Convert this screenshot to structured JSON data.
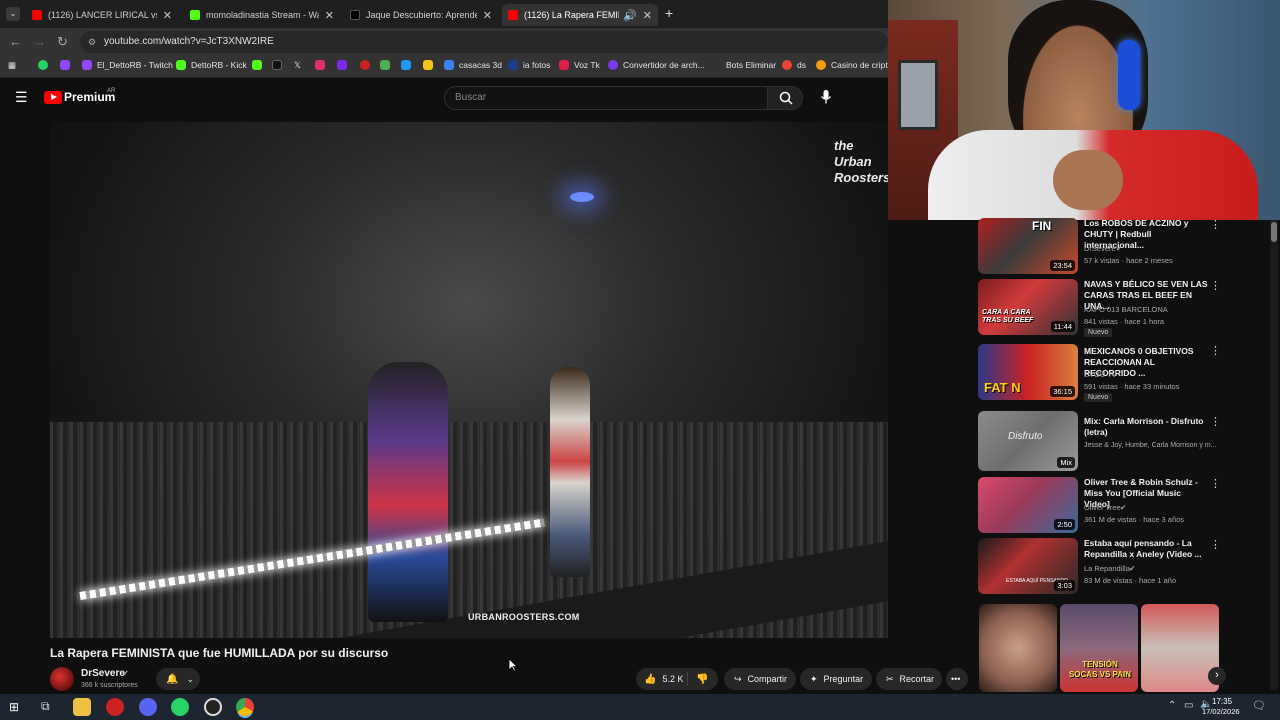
{
  "tabs": [
    {
      "title": "(1126) LANCER LIRICAL vs CHA",
      "active": false
    },
    {
      "title": "momoladinastia Stream - Watc",
      "active": false
    },
    {
      "title": "Jaque Descubierto: Aprender d",
      "active": false
    },
    {
      "title": "(1126) La Rapera FEMINIST",
      "active": true
    }
  ],
  "address": {
    "url": "youtube.com/watch?v=JcT3XNW2IRE"
  },
  "bookmarks": [
    "El_DettoRB - Twitch",
    "DettoRB - Kick",
    "casacas 3d",
    "ia fotos",
    "Voz Tk",
    "Convertidor de arch...",
    "Bots Eliminar",
    "ds",
    "Casino de cripto"
  ],
  "youtube": {
    "logo_text": "Premium",
    "logo_region": "AR",
    "search_placeholder": "Buscar"
  },
  "video": {
    "watermark": "URBANROOSTERS.COM",
    "corner_logo": "the Urban Roosters",
    "title": "La Rapera FEMINISTA que fue HUMILLADA por su discurso",
    "channel": "DrSevere",
    "subscribers": "366 k suscriptores",
    "likes": "5.2 K",
    "share_label": "Compartir",
    "ask_label": "Preguntar",
    "clip_label": "Recortar"
  },
  "recommendations": [
    {
      "title": "Los ROBOS DE ACZINO y CHUTY | Redbull internacional...",
      "channel": "DrSevere",
      "verified": true,
      "meta": "57 k vistas · hace 2 meses",
      "duration": "23:54",
      "nuevo": false,
      "thumb_text": "FIN"
    },
    {
      "title": "NAVAS Y BÉLICO SE VEN LAS CARAS TRAS EL BEEF EN UNA...",
      "channel": "KAPO 013 BARCELONA",
      "verified": false,
      "meta": "841 vistas · hace 1 hora",
      "duration": "11:44",
      "nuevo": true,
      "thumb_text": "CARA A CARA TRAS SU BEEF"
    },
    {
      "title": "MEXICANOS 0 OBJETIVOS REACCIONAN AL RECORRIDO ...",
      "channel": "EYOU TV",
      "verified": false,
      "meta": "591 vistas · hace 33 minutos",
      "duration": "36:15",
      "nuevo": true,
      "thumb_text": "FAT N"
    },
    {
      "title": "Mix: Carla Morrison - Disfruto (letra)",
      "channel": "Jesse & Joy, Humbe, Carla Morrison y m...",
      "verified": false,
      "meta": "",
      "duration": "Mix",
      "nuevo": false,
      "thumb_text": "Disfruto"
    },
    {
      "title": "Oliver Tree & Robin Schulz - Miss You [Official Music Video]",
      "channel": "Oliver Tree",
      "verified": true,
      "meta": "361 M de vistas · hace 3 años",
      "duration": "2:50",
      "nuevo": false,
      "thumb_text": ""
    },
    {
      "title": "Estaba aquí pensando - La Repandilla x Aneley (Video ...",
      "channel": "La Repandilla",
      "verified": true,
      "meta": "83 M de vistas · hace 1 año",
      "duration": "3:03",
      "nuevo": false,
      "thumb_text": "ESTABA AQUÍ PENSANDO"
    }
  ],
  "shorts": {
    "thumb_text": "TENSIÓN SOCAS VS PAIN"
  },
  "nuevo_label": "Nuevo",
  "taskbar": {
    "time": "17:35",
    "date": "17/02/2026"
  },
  "colors": {
    "youtube_red": "#ff0000",
    "bg": "#0f0f0f",
    "chip": "#272727"
  }
}
